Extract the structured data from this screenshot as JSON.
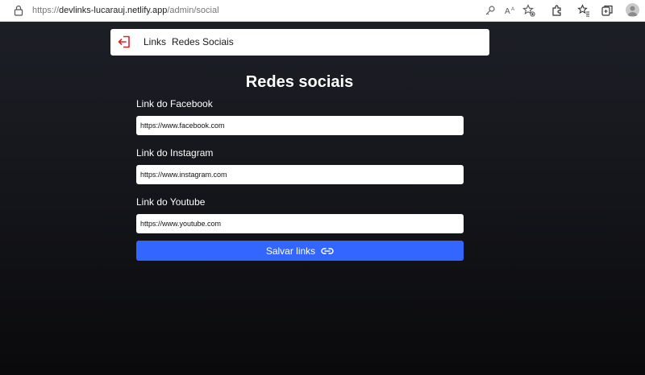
{
  "browser": {
    "url_scheme": "https://",
    "url_host": "devlinks-lucarauj.netlify.app",
    "url_path": "/admin/social",
    "icons": [
      "lock-icon",
      "key-icon",
      "read-aloud-icon",
      "favorite-star-icon",
      "extensions-icon",
      "favorites-icon",
      "collections-icon",
      "profile-avatar-icon"
    ]
  },
  "navbar": {
    "logout_icon": "logout-icon",
    "links": [
      "Links",
      "Redes Sociais"
    ],
    "logout_color": "#e0202a"
  },
  "main": {
    "title": "Redes sociais",
    "fields": [
      {
        "label": "Link do Facebook",
        "value": "https://www.facebook.com"
      },
      {
        "label": "Link do Instagram",
        "value": "https://www.instagram.com"
      },
      {
        "label": "Link do Youtube",
        "value": "https://www.youtube.com"
      }
    ],
    "save_button": "Salvar links",
    "save_icon": "link-icon",
    "accent_color": "#3366ff"
  }
}
